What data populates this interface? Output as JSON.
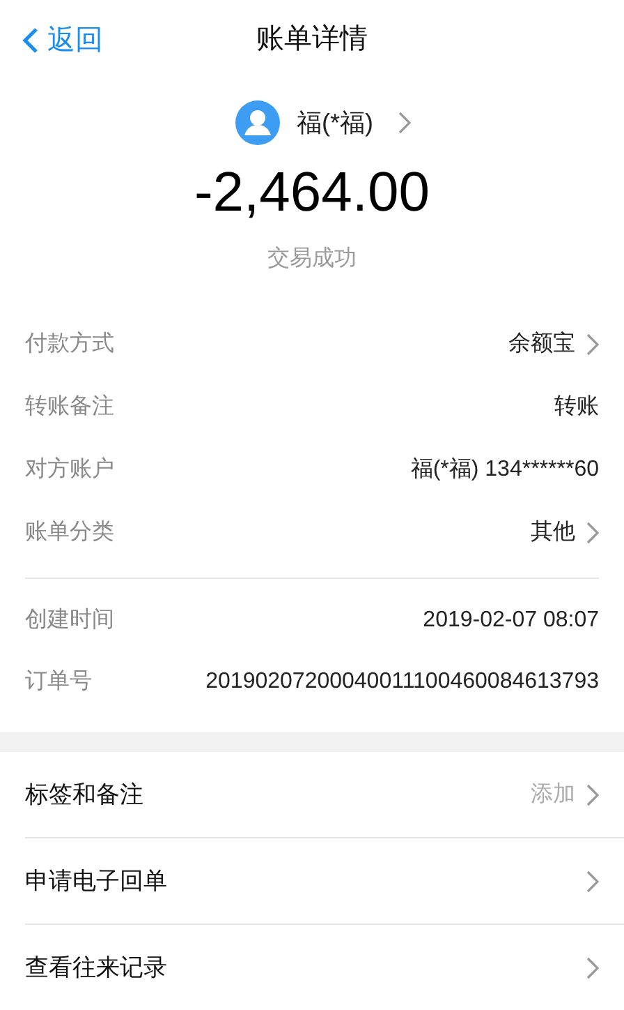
{
  "nav": {
    "back": "返回",
    "title": "账单详情"
  },
  "payee": {
    "name": "福(*福)"
  },
  "amount": "-2,464.00",
  "status": "交易成功",
  "details": [
    {
      "label": "付款方式",
      "value": "余额宝",
      "arrow": true
    },
    {
      "label": "转账备注",
      "value": "转账",
      "arrow": false
    },
    {
      "label": "对方账户",
      "value": "福(*福) 134******60",
      "arrow": false
    },
    {
      "label": "账单分类",
      "value": "其他",
      "arrow": true
    }
  ],
  "order_info": [
    {
      "label": "创建时间",
      "value": "2019-02-07 08:07"
    },
    {
      "label": "订单号",
      "value": "20190207200040011100460084613793"
    }
  ],
  "actions": [
    {
      "label": "标签和备注",
      "hint": "添加"
    },
    {
      "label": "申请电子回单"
    },
    {
      "label": "查看往来记录"
    }
  ]
}
